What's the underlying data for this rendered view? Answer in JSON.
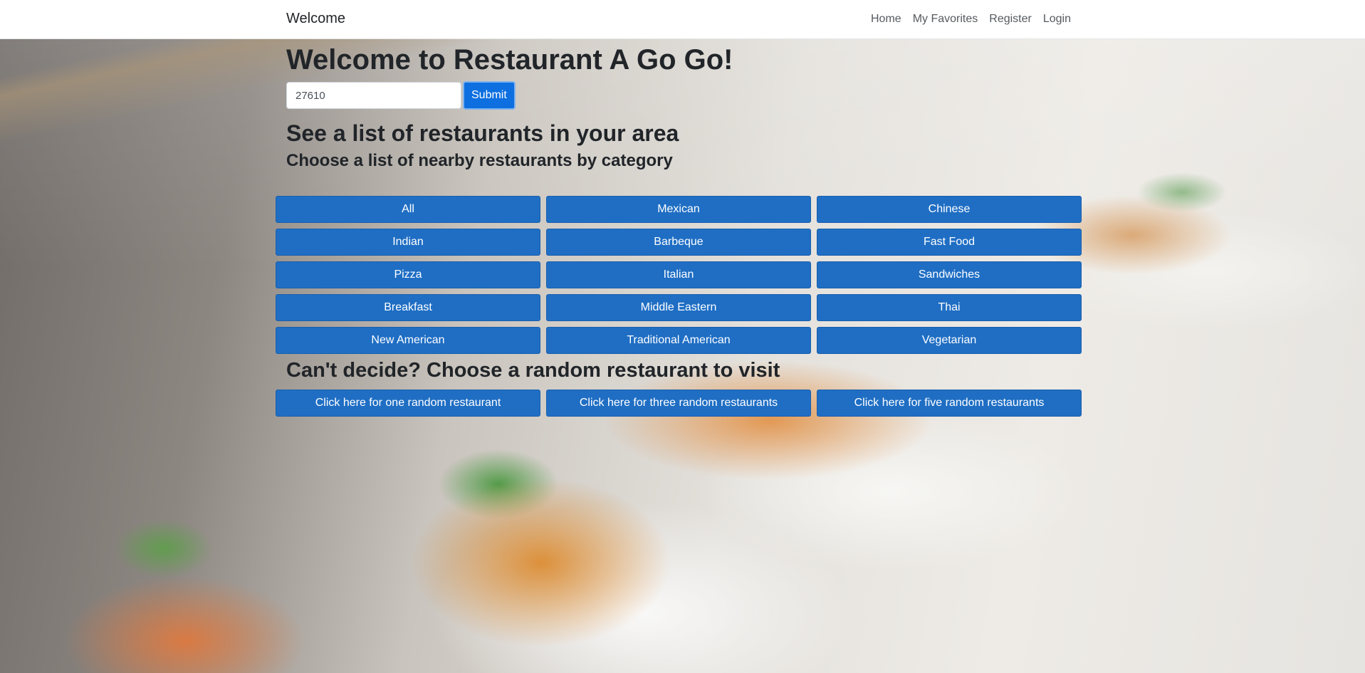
{
  "navbar": {
    "brand": "Welcome",
    "links": [
      "Home",
      "My Favorites",
      "Register",
      "Login"
    ]
  },
  "main": {
    "title": "Welcome to Restaurant A Go Go!",
    "zip_input": {
      "value": "27610",
      "placeholder": ""
    },
    "submit_label": "Submit",
    "area_heading": "See a list of restaurants in your area",
    "category_heading": "Choose a list of nearby restaurants by category",
    "categories": [
      "All",
      "Mexican",
      "Chinese",
      "Indian",
      "Barbeque",
      "Fast Food",
      "Pizza",
      "Italian",
      "Sandwiches",
      "Breakfast",
      "Middle Eastern",
      "Thai",
      "New American",
      "Traditional American",
      "Vegetarian"
    ],
    "random_heading": "Can't decide? Choose a random restaurant to visit",
    "random_buttons": [
      "Click here for one random restaurant",
      "Click here for three random restaurants",
      "Click here for five random restaurants"
    ]
  },
  "colors": {
    "button": "#1f6ec4",
    "submit": "#0d6fe0"
  }
}
